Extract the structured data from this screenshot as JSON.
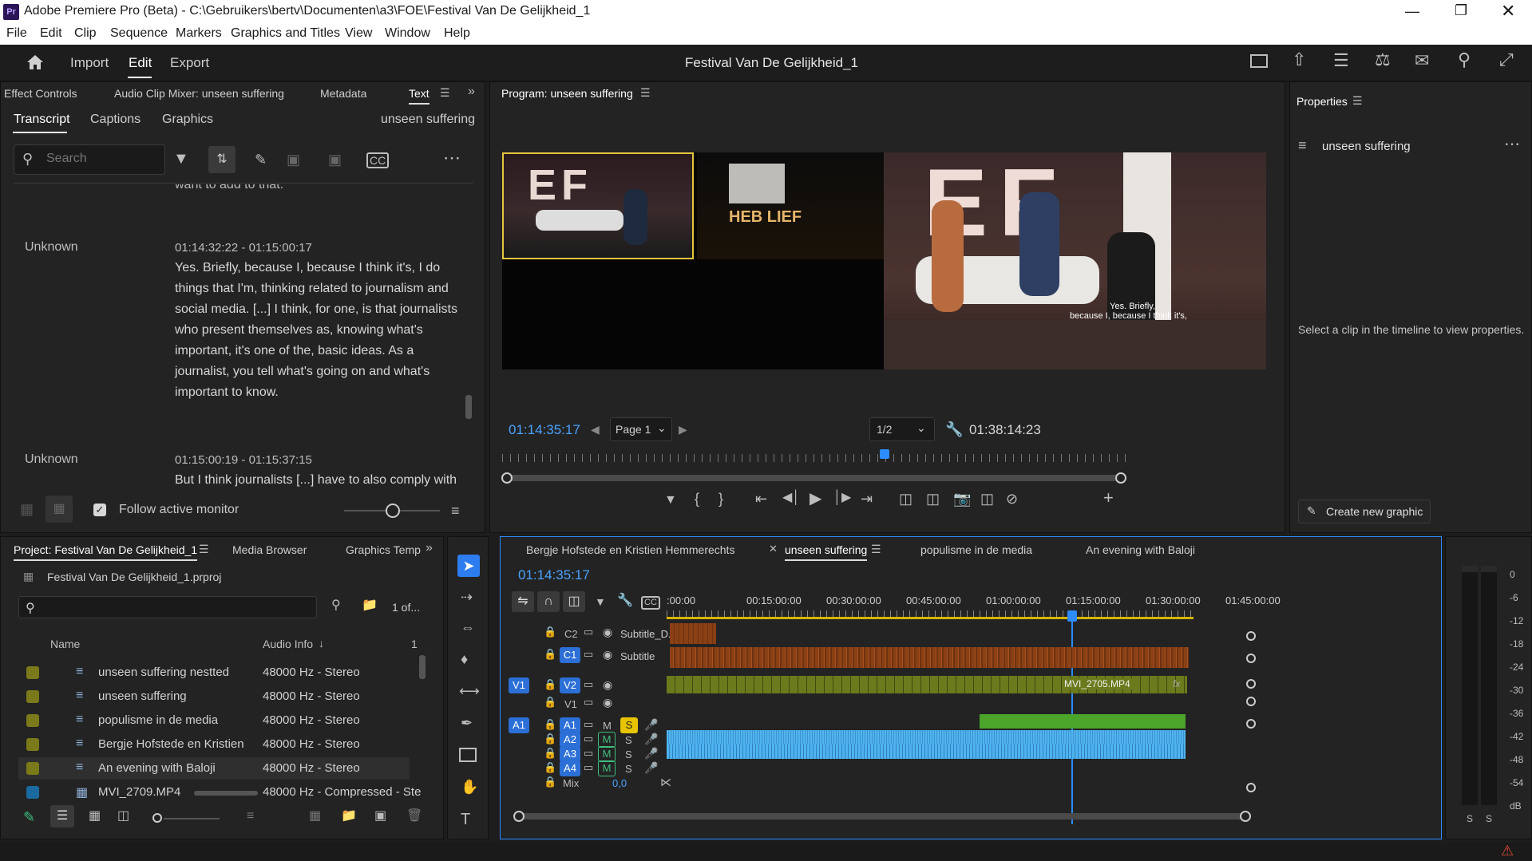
{
  "app": {
    "title": "Adobe Premiere Pro (Beta) - C:\\Gebruikers\\bertv\\Documenten\\a3\\FOE\\Festival Van De Gelijkheid_1",
    "logo": "Pr"
  },
  "menu": [
    "File",
    "Edit",
    "Clip",
    "Sequence",
    "Markers",
    "Graphics and Titles",
    "View",
    "Window",
    "Help"
  ],
  "workspace": {
    "home_icon": "home-icon",
    "tabs": [
      "Import",
      "Edit",
      "Export"
    ],
    "project_title": "Festival Van De Gelijkheid_1"
  },
  "left_panel": {
    "tabs": [
      "Effect Controls",
      "Audio Clip Mixer: unseen suffering",
      "Metadata",
      "Text"
    ],
    "subtabs": [
      "Transcript",
      "Captions",
      "Graphics"
    ],
    "sequence_name": "unseen suffering",
    "search_placeholder": "Search",
    "cut_text": "want to add to that.",
    "entries": [
      {
        "speaker": "Unknown",
        "time": "01:14:32:22 - 01:15:00:17",
        "lines": [
          "Yes. Briefly, because I, because I think it's, I do",
          "things that I'm, thinking related to journalism and",
          "social media. [...] I think, for one, is that journalists",
          "who present themselves as, knowing what's",
          "important, it's one of the, basic ideas. As a",
          "journalist, you tell what's going on and what's",
          "important to know."
        ]
      },
      {
        "speaker": "Unknown",
        "time": "01:15:00:19 - 01:15:37:15",
        "lines": [
          "But I think journalists [...] have to also comply with"
        ]
      }
    ],
    "follow_label": "Follow active monitor"
  },
  "program": {
    "title": "Program: unseen suffering",
    "timecode": "01:14:35:17",
    "page_select": "Page 1",
    "fraction": "1/2",
    "duration": "01:38:14:23",
    "caption_line1": "Yes. Briefly,",
    "caption_line2": "because I, because I think it's,",
    "backdrop_letters": "EF",
    "sign_text": "HEB LIEF"
  },
  "properties": {
    "title": "Properties",
    "item": "unseen suffering",
    "hint": "Select a clip in the timeline to view properties.",
    "create_label": "Create new graphic"
  },
  "project": {
    "tabs": [
      "Project: Festival Van De Gelijkheid_1",
      "Media Browser",
      "Graphics Temp"
    ],
    "file": "Festival Van De Gelijkheid_1.prproj",
    "count": "1 of...",
    "col_name": "Name",
    "col_audio": "Audio Info",
    "col_num": "1",
    "items": [
      {
        "name": "unseen suffering nestted",
        "audio": "48000 Hz - Stereo",
        "color": "#7a7a1a"
      },
      {
        "name": "unseen suffering",
        "audio": "48000 Hz - Stereo",
        "color": "#7a7a1a"
      },
      {
        "name": "populisme in de media",
        "audio": "48000 Hz - Stereo",
        "color": "#7a7a1a"
      },
      {
        "name": "Bergje Hofstede en Kristien",
        "audio": "48000 Hz - Stereo",
        "color": "#7a7a1a"
      },
      {
        "name": "An evening with Baloji",
        "audio": "48000 Hz - Stereo",
        "color": "#7a7a1a"
      },
      {
        "name": "MVI_2709.MP4",
        "audio": "48000 Hz - Compressed - Ste",
        "color": "#1a6aa0"
      }
    ]
  },
  "timeline": {
    "tabs": [
      "Bergje Hofstede en Kristien Hemmerechts",
      "unseen suffering",
      "populisme in de media",
      "An evening with Baloji"
    ],
    "timecode": "01:14:35:17",
    "ruler": [
      ":00:00",
      "00:15:00:00",
      "00:30:00:00",
      "00:45:00:00",
      "01:00:00:00",
      "01:15:00:00",
      "01:30:00:00",
      "01:45:00:00"
    ],
    "tracks": {
      "c2": "C2",
      "c2_name": "Subtitle_D...",
      "c1": "C1",
      "c1_name": "Subtitle",
      "v1_src": "V1",
      "v2": "V2",
      "v1": "V1",
      "a1_src": "A1",
      "a1": "A1",
      "a2": "A2",
      "a3": "A3",
      "a4": "A4",
      "m": "M",
      "s": "S",
      "mix": "Mix",
      "mix_val": "0,0"
    },
    "clip_name": "MVI_2705.MP4",
    "clip_fx": "fx"
  },
  "meter": {
    "labels": [
      "0",
      "-6",
      "-12",
      "-18",
      "-24",
      "-30",
      "-36",
      "-42",
      "-48",
      "-54",
      "dB"
    ],
    "solo": [
      "S",
      "S"
    ]
  },
  "colors": {
    "accent": "#2d8cff",
    "timecode": "#4aa3ff",
    "caption_clip": "#8a4015",
    "video_clip": "#6b7a1c",
    "audio_clip": "#4fb4ef",
    "audio_mix_clip": "#4aa52a"
  }
}
